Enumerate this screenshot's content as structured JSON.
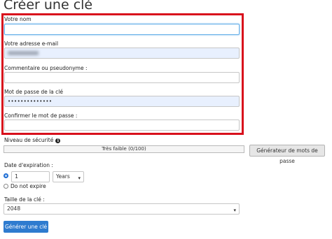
{
  "page": {
    "title": "Créer une clé"
  },
  "form": {
    "name_label": "Votre nom",
    "name_value": "",
    "email_label": "Votre adresse e-mail",
    "comment_label": "Commentaire ou pseudonyme :",
    "comment_value": "",
    "password_label": "Mot de passe de la clé",
    "password_value": "••••••••••••••",
    "confirm_label": "Confirmer le mot de passe :",
    "confirm_value": ""
  },
  "security": {
    "label": "Niveau de sécurité",
    "meter_text": "Très faible (0/100)",
    "generator_button": "Générateur de mots de passe",
    "info_icon": "info-icon"
  },
  "expiration": {
    "label": "Date d'expiration :",
    "amount": "1",
    "unit": "Years",
    "never_label": "Do not expire"
  },
  "key_size": {
    "label": "Taille de la clé :",
    "value": "2048"
  },
  "submit": {
    "label": "Générer une clé"
  },
  "colors": {
    "highlight": "#d8101c",
    "primary": "#2e7bcf"
  }
}
